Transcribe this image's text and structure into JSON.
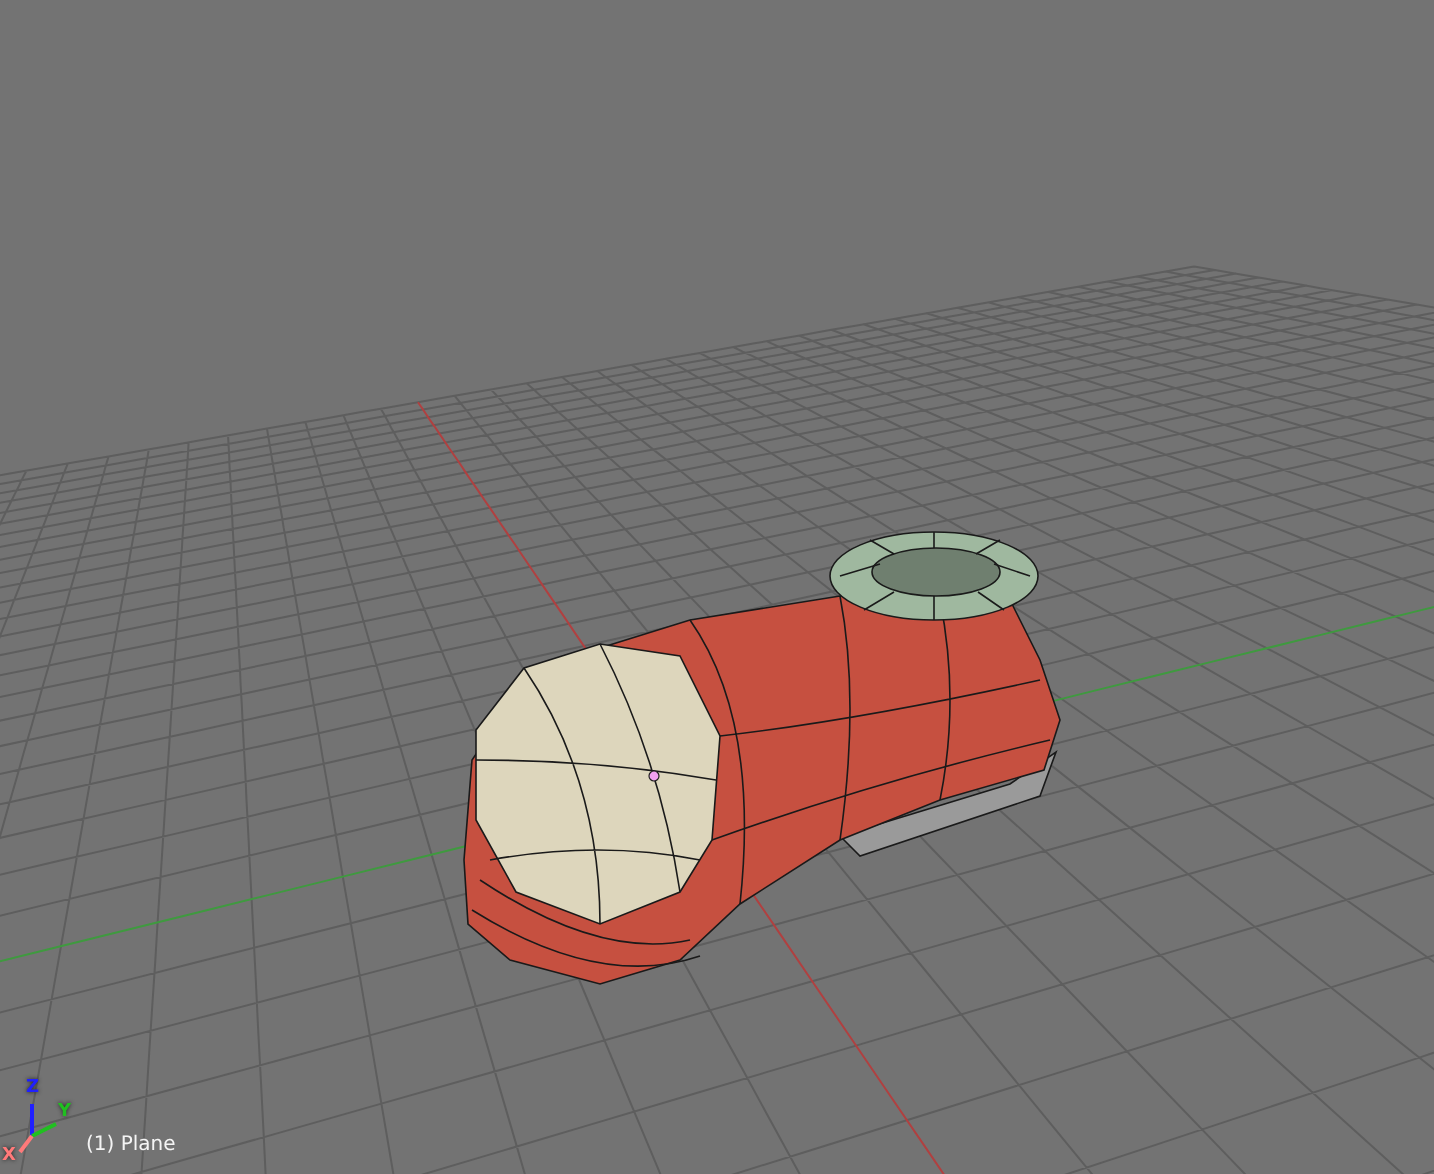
{
  "viewport": {
    "object_label": "(1) Plane",
    "axes": [
      {
        "label": "Z",
        "color": "#2020ff"
      },
      {
        "label": "Y",
        "color": "#20c020"
      },
      {
        "label": "X",
        "color": "#ff7a7a"
      }
    ]
  }
}
